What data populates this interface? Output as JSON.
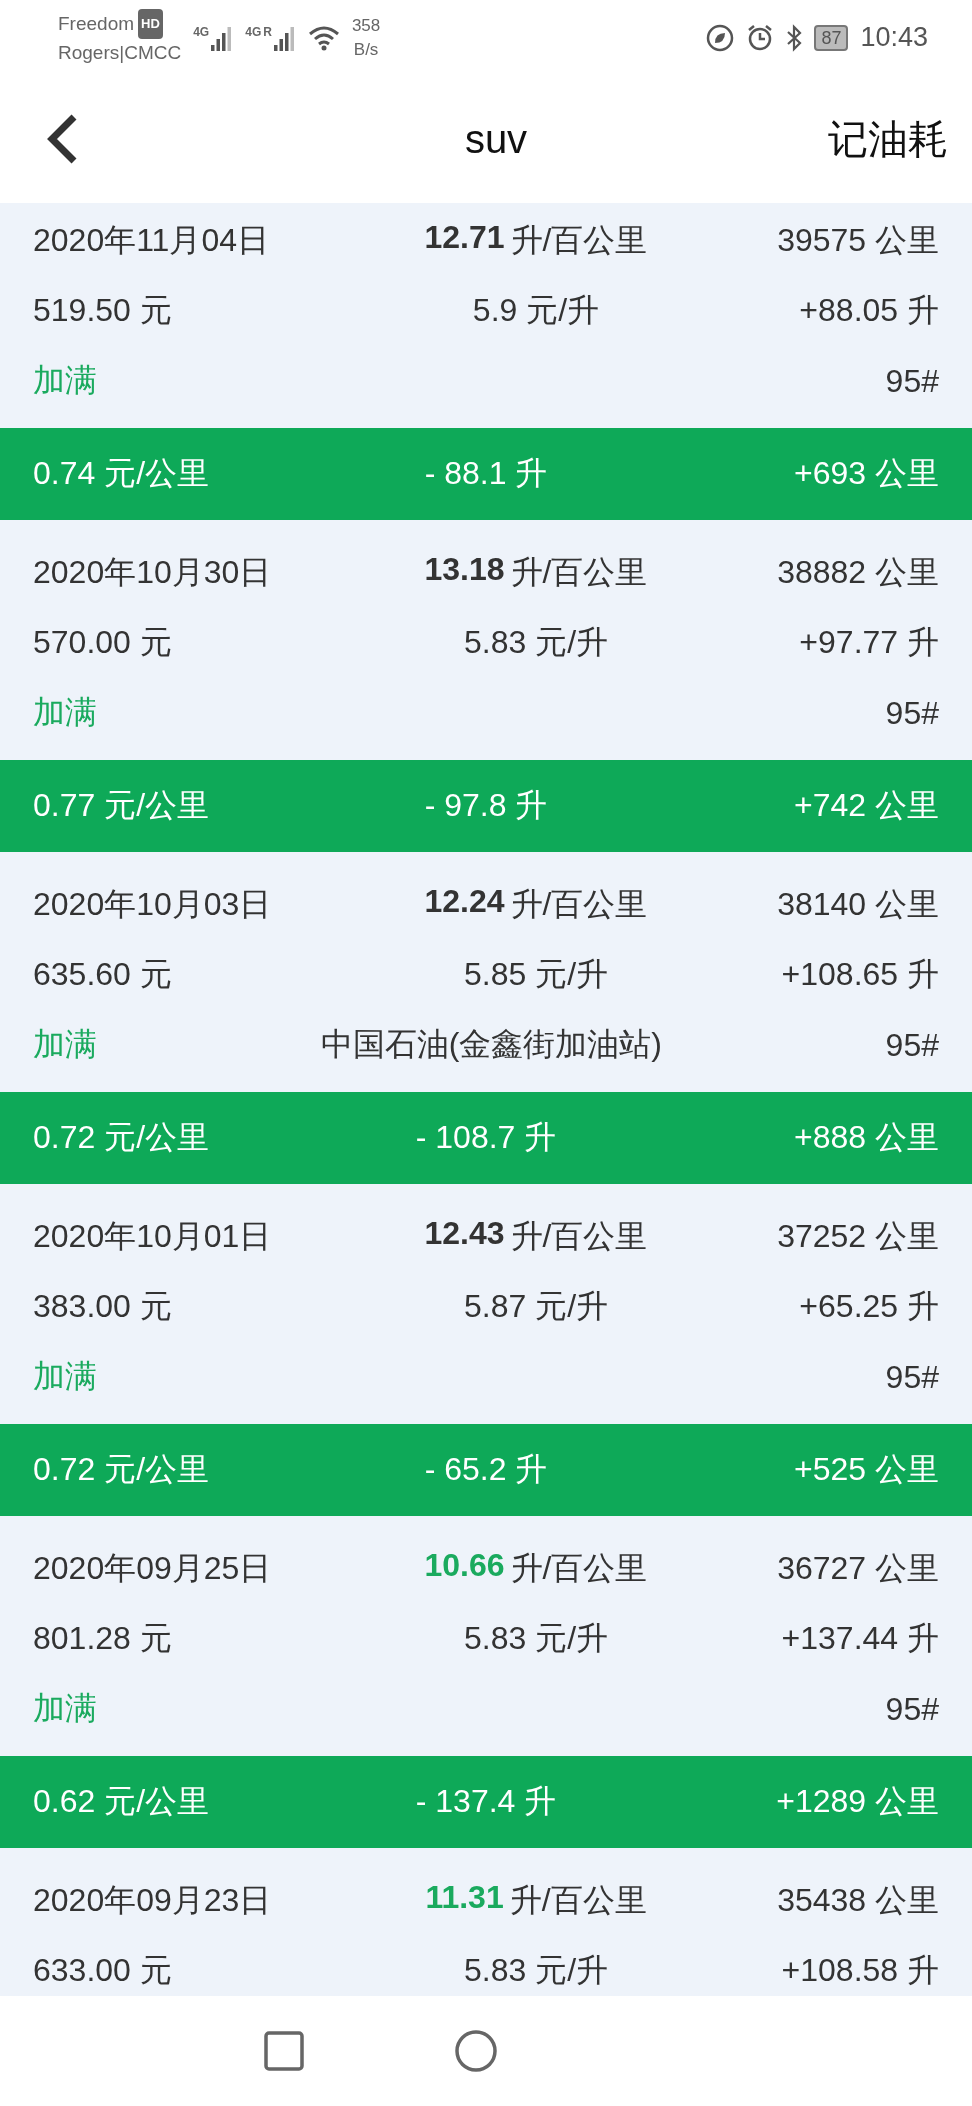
{
  "status_bar": {
    "carrier_1": "Freedom",
    "carrier_1_badge": "HD",
    "carrier_2": "Rogers|CMCC",
    "network_1": "4G",
    "network_2": "4G",
    "network_2_suffix": "R",
    "speed_value": "358",
    "speed_unit": "B/s",
    "battery": "87",
    "time": "10:43"
  },
  "header": {
    "title": "suv",
    "action": "记油耗"
  },
  "records": [
    {
      "date": "2020年11月04日",
      "consumption": "12.71",
      "consumption_unit": "升/百公里",
      "highlight": false,
      "odometer": "39575 公里",
      "cost": "519.50 元",
      "price": "5.9 元/升",
      "volume": "+88.05 升",
      "fill": "加满",
      "grade": "95#",
      "summary": {
        "cost_per_km": "0.74 元/公里",
        "fuel_used": "- 88.1 升",
        "distance": "+693 公里"
      }
    },
    {
      "date": "2020年10月30日",
      "consumption": "13.18",
      "consumption_unit": "升/百公里",
      "highlight": false,
      "odometer": "38882 公里",
      "cost": "570.00 元",
      "price": "5.83 元/升",
      "volume": "+97.77 升",
      "fill": "加满",
      "grade": "95#",
      "summary": {
        "cost_per_km": "0.77 元/公里",
        "fuel_used": "- 97.8 升",
        "distance": "+742 公里"
      }
    },
    {
      "date": "2020年10月03日",
      "consumption": "12.24",
      "consumption_unit": "升/百公里",
      "highlight": false,
      "odometer": "38140 公里",
      "cost": "635.60 元",
      "price": "5.85 元/升",
      "volume": "+108.65 升",
      "fill": "加满",
      "station": "中国石油(金鑫街加油站)",
      "grade": "95#",
      "summary": {
        "cost_per_km": "0.72 元/公里",
        "fuel_used": "- 108.7 升",
        "distance": "+888 公里"
      }
    },
    {
      "date": "2020年10月01日",
      "consumption": "12.43",
      "consumption_unit": "升/百公里",
      "highlight": false,
      "odometer": "37252 公里",
      "cost": "383.00 元",
      "price": "5.87 元/升",
      "volume": "+65.25 升",
      "fill": "加满",
      "grade": "95#",
      "summary": {
        "cost_per_km": "0.72 元/公里",
        "fuel_used": "- 65.2 升",
        "distance": "+525 公里"
      }
    },
    {
      "date": "2020年09月25日",
      "consumption": "10.66",
      "consumption_unit": "升/百公里",
      "highlight": true,
      "odometer": "36727 公里",
      "cost": "801.28 元",
      "price": "5.83 元/升",
      "volume": "+137.44 升",
      "fill": "加满",
      "grade": "95#",
      "summary": {
        "cost_per_km": "0.62 元/公里",
        "fuel_used": "- 137.4 升",
        "distance": "+1289 公里"
      }
    },
    {
      "date": "2020年09月23日",
      "consumption": "11.31",
      "consumption_unit": "升/百公里",
      "highlight": true,
      "odometer": "35438 公里",
      "cost": "633.00 元",
      "price": "5.83 元/升",
      "volume": "+108.58 升"
    }
  ]
}
